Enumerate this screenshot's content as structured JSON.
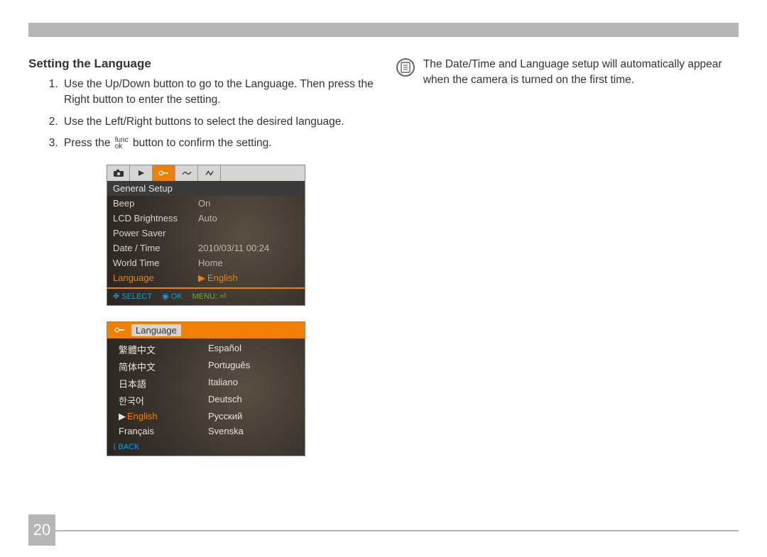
{
  "page_number": "20",
  "heading": "Setting the Language",
  "steps": [
    "Use the Up/Down button to go to the Language. Then press the Right button to enter the setting.",
    "Use the Left/Right buttons to select the desired language.",
    {
      "pre": "Press the ",
      "func_top": "func",
      "func_bot": "ok",
      "post": " button to confirm the setting."
    }
  ],
  "note": "The Date/Time and Language setup will automatically appear when the camera is turned on the first time.",
  "lcd1": {
    "title": "General Setup",
    "rows": [
      {
        "k": "Beep",
        "v": "On"
      },
      {
        "k": "LCD Brightness",
        "v": "Auto"
      },
      {
        "k": "Power Saver",
        "v": ""
      },
      {
        "k": "Date / Time",
        "v": "2010/03/11 00:24"
      },
      {
        "k": "World Time",
        "v": "Home"
      },
      {
        "k": "Language",
        "v": "English",
        "sel": true
      }
    ],
    "foot_select": "SELECT",
    "foot_ok": "OK",
    "foot_menu": "MENU:"
  },
  "lcd2": {
    "title": "Language",
    "langs_left": [
      "繁體中文",
      "简体中文",
      "日本語",
      "한국어",
      {
        "t": "English",
        "sel": true
      },
      "Français"
    ],
    "langs_right": [
      "Español",
      "Português",
      "Italiano",
      "Deutsch",
      "Русский",
      "Svenska"
    ],
    "back": "BACK"
  }
}
